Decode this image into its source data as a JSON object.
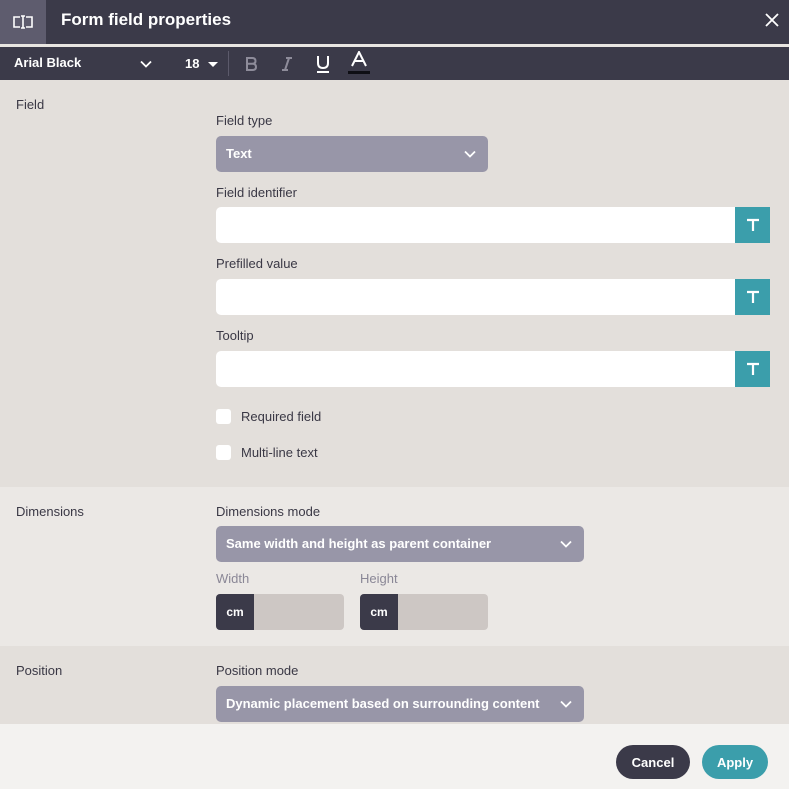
{
  "dialog": {
    "title": "Form field properties"
  },
  "toolbar": {
    "font_family": "Arial Black",
    "font_size": "18",
    "buttons": [
      "bold-icon",
      "italic-icon",
      "underline-icon",
      "font-color-icon"
    ]
  },
  "sections": {
    "field": {
      "label": "Field",
      "field_type_label": "Field type",
      "field_type_value": "Text",
      "identifier_label": "Field identifier",
      "identifier_value": "",
      "prefilled_label": "Prefilled value",
      "prefilled_value": "",
      "tooltip_label": "Tooltip",
      "tooltip_value": "",
      "required_label": "Required field",
      "multiline_label": "Multi-line text",
      "t_button_glyph": "T"
    },
    "dimensions": {
      "label": "Dimensions",
      "mode_label": "Dimensions mode",
      "mode_value": "Same width and height as parent container",
      "width_label": "Width",
      "height_label": "Height",
      "unit": "cm",
      "width_value": "",
      "height_value": ""
    },
    "position": {
      "label": "Position",
      "mode_label": "Position mode",
      "mode_value": "Dynamic placement based on surrounding content"
    }
  },
  "footer": {
    "cancel_label": "Cancel",
    "apply_label": "Apply"
  },
  "colors": {
    "header": "#3b3a49",
    "accent": "#3b9eab",
    "select": "#9896a8"
  }
}
